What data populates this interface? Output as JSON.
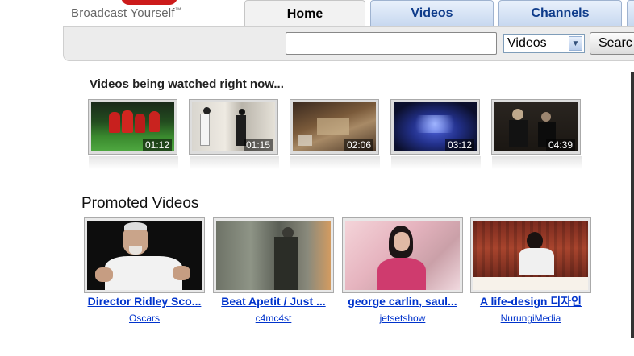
{
  "header": {
    "tagline": "Broadcast Yourself",
    "tagline_mark": "™",
    "tabs": [
      {
        "label": "Home",
        "active": true
      },
      {
        "label": "Videos",
        "active": false
      },
      {
        "label": "Channels",
        "active": false
      }
    ]
  },
  "search": {
    "value": "",
    "scope_selected": "Videos",
    "button_label": "Searc"
  },
  "watching_now": {
    "title": "Videos being watched right now...",
    "videos": [
      {
        "duration": "01:12"
      },
      {
        "duration": "01:15"
      },
      {
        "duration": "02:06"
      },
      {
        "duration": "03:12"
      },
      {
        "duration": "04:39"
      }
    ]
  },
  "promoted": {
    "title": "Promoted Videos",
    "videos": [
      {
        "title": "Director Ridley Sco...",
        "user": "Oscars"
      },
      {
        "title": "Beat Apetit / Just ...",
        "user": "c4mc4st"
      },
      {
        "title": "george carlin, saul...",
        "user": "jetsetshow"
      },
      {
        "title": "A life-design 디자인",
        "title_line2": "",
        "user": "NurungiMedia"
      }
    ]
  },
  "colors": {
    "link": "#0033cc",
    "tab_text": "#0e3b8a",
    "brand_red": "#cc1b1b"
  }
}
